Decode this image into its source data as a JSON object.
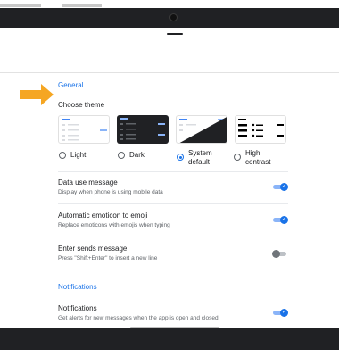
{
  "sections": {
    "general_title": "General",
    "notifications_title": "Notifications"
  },
  "theme": {
    "label": "Choose theme",
    "options": [
      {
        "label": "Light",
        "selected": false
      },
      {
        "label": "Dark",
        "selected": false
      },
      {
        "label": "System default",
        "selected": true
      },
      {
        "label": "High contrast",
        "selected": false
      }
    ]
  },
  "settings": [
    {
      "title": "Data use message",
      "description": "Display when phone is using mobile data",
      "enabled": true
    },
    {
      "title": "Automatic emoticon to emoji",
      "description": "Replace emoticons with emojis when typing",
      "enabled": true
    },
    {
      "title": "Enter sends message",
      "description": "Press \"Shift+Enter\" to insert a new line",
      "enabled": false
    }
  ],
  "notifications": {
    "title": "Notifications",
    "description": "Get alerts for new messages when the app is open and closed",
    "enabled": true
  },
  "colors": {
    "accent": "#1a73e8",
    "pointer_arrow": "#f5a623",
    "bezel": "#202124"
  },
  "icons": {
    "pointer": "arrow-right-icon",
    "toggle_on": "check-icon",
    "toggle_off": "minus-icon"
  }
}
